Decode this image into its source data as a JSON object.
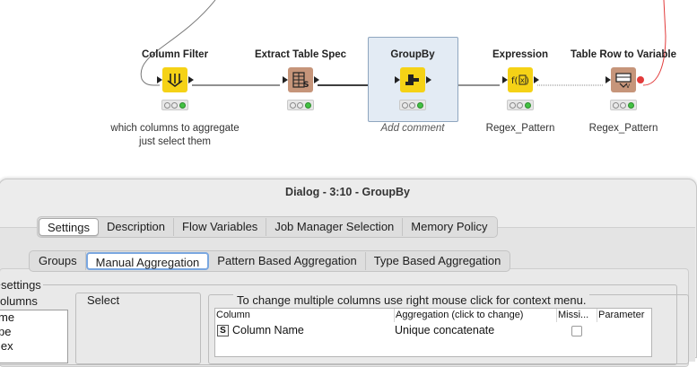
{
  "workflow": {
    "nodes": [
      {
        "title": "Column Filter",
        "icon": "column-filter-icon",
        "color": "#f5d216",
        "comment": "which columns to aggregate just select them",
        "comment_style": "normal",
        "out_port": "data"
      },
      {
        "title": "Extract Table Spec",
        "icon": "extract-table-spec-icon",
        "color": "#c6957a",
        "comment": "",
        "comment_style": "normal",
        "out_port": "data"
      },
      {
        "title": "GroupBy",
        "icon": "groupby-icon",
        "color": "#f5d216",
        "comment": "Add comment",
        "comment_style": "italic",
        "out_port": "data",
        "selected": true
      },
      {
        "title": "Expression",
        "icon": "expression-icon",
        "color": "#f5d216",
        "comment": "Regex_Pattern",
        "comment_style": "normal",
        "out_port": "data"
      },
      {
        "title": "Table Row to Variable",
        "icon": "table-row-to-variable-icon",
        "color": "#c6957a",
        "comment": "Regex_Pattern",
        "comment_style": "normal",
        "out_port": "variable"
      }
    ],
    "connection_color": "#222222",
    "variable_connection_color": "#e23b3b"
  },
  "dialog": {
    "title": "Dialog - 3:10 - GroupBy",
    "main_tabs": [
      {
        "label": "Settings",
        "selected": true
      },
      {
        "label": "Description",
        "selected": false
      },
      {
        "label": "Flow Variables",
        "selected": false
      },
      {
        "label": "Job Manager Selection",
        "selected": false
      },
      {
        "label": "Memory Policy",
        "selected": false
      }
    ],
    "sub_tabs": [
      {
        "label": "Groups",
        "selected": false
      },
      {
        "label": "Manual Aggregation",
        "selected": true
      },
      {
        "label": "Pattern Based Aggregation",
        "selected": false
      },
      {
        "label": "Type Based Aggregation",
        "selected": false
      }
    ],
    "settings_group_label": "settings",
    "columns_label": "olumns",
    "column_list": [
      "me",
      "pe",
      "lex"
    ],
    "select_label": "Select",
    "hint": "To change multiple columns use right mouse click for context menu.",
    "table": {
      "headers": [
        "Column",
        "Aggregation (click to change)",
        "Missi...",
        "Parameter"
      ],
      "rows": [
        {
          "type": "S",
          "column": "Column Name",
          "aggregation": "Unique concatenate",
          "missing": false,
          "parameter": ""
        }
      ]
    }
  }
}
